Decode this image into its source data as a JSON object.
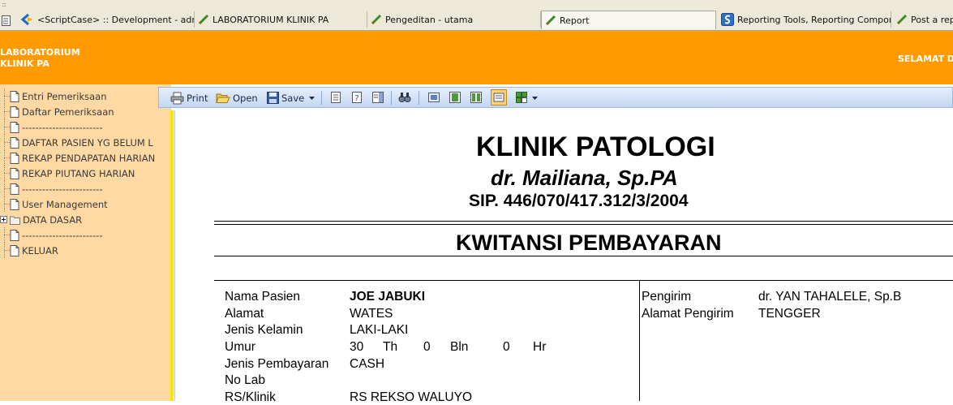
{
  "browser": {
    "grip": ":::",
    "tabs": [
      {
        "label": "<ScriptCase> :: Development - admin",
        "icon": "scriptcase-icon"
      },
      {
        "label": "LABORATORIUM KLINIK PA",
        "icon": "page-icon"
      },
      {
        "label": "Pengeditan - utama",
        "icon": "page-icon"
      },
      {
        "label": "Report",
        "icon": "page-icon"
      },
      {
        "label": "Reporting Tools, Reporting Compone...",
        "icon": "site-icon"
      },
      {
        "label": "Post a repl",
        "icon": "page-icon"
      }
    ]
  },
  "header": {
    "brand_line1": "LABORATORIUM",
    "brand_line2": "KLINIK PA",
    "greeting": "SELAMAT DA",
    "background": "#ff9b00"
  },
  "sidebar": {
    "items": [
      {
        "label": "Entri Pemeriksaan",
        "icon": "document-icon"
      },
      {
        "label": "Daftar Pemeriksaan",
        "icon": "document-icon"
      },
      {
        "label": "------------------------",
        "icon": "document-icon"
      },
      {
        "label": "DAFTAR PASIEN YG BELUM L",
        "icon": "document-icon"
      },
      {
        "label": "REKAP PENDAPATAN HARIAN",
        "icon": "document-icon"
      },
      {
        "label": "REKAP PIUTANG HARIAN",
        "icon": "document-icon"
      },
      {
        "label": "------------------------",
        "icon": "document-icon"
      },
      {
        "label": "User Management",
        "icon": "document-icon"
      },
      {
        "label": "DATA DASAR",
        "icon": "folder-icon"
      },
      {
        "label": "------------------------",
        "icon": "document-icon"
      },
      {
        "label": "KELUAR",
        "icon": "document-icon"
      }
    ]
  },
  "toolbar": {
    "print_label": "Print",
    "open_label": "Open",
    "save_label": "Save"
  },
  "report": {
    "clinic_name": "KLINIK PATOLOGI",
    "doctor": "dr. Mailiana, Sp.PA",
    "sip": "SIP. 446/070/417.312/3/2004",
    "title": "KWITANSI PEMBAYARAN",
    "patient": {
      "name_label": "Nama Pasien",
      "name": "JOE JABUKI",
      "address_label": "Alamat",
      "address": "WATES",
      "gender_label": "Jenis Kelamin",
      "gender": "LAKI-LAKI",
      "age_label": "Umur",
      "age_years": "30",
      "age_years_unit": "Th",
      "age_months": "0",
      "age_months_unit": "Bln",
      "age_days": "0",
      "age_days_unit": "Hr",
      "payment_label": "Jenis Pembayaran",
      "payment": "CASH",
      "lab_no_label": "No Lab",
      "lab_no": "",
      "clinic_label": "RS/Klinik",
      "clinic": "RS REKSO WALUYO"
    },
    "sender": {
      "sender_label": "Pengirim",
      "sender": "dr. YAN TAHALELE, Sp.B",
      "sender_address_label": "Alamat Pengirim",
      "sender_address": "TENGGER"
    }
  }
}
